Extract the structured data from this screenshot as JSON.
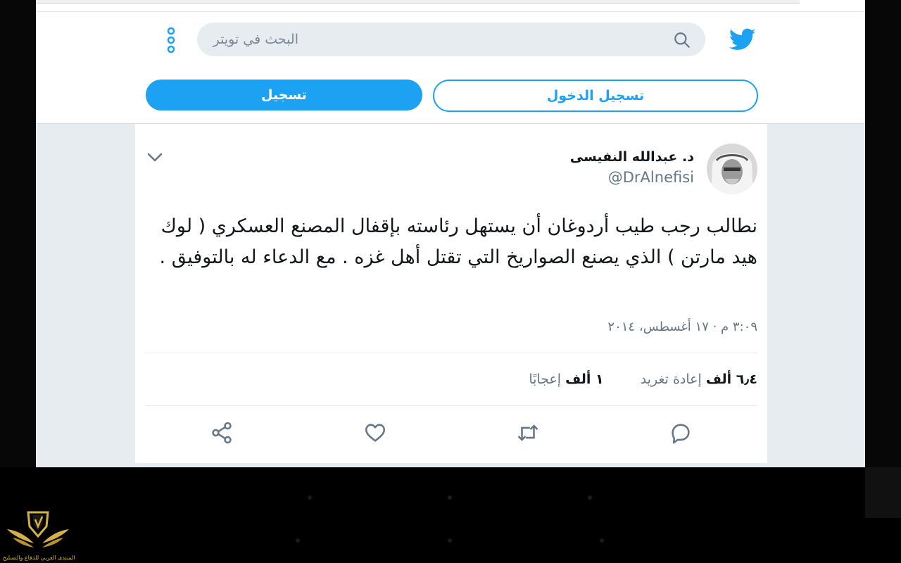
{
  "header": {
    "search_placeholder": "البحث في تويتر",
    "login_label": "تسجيل الدخول",
    "signup_label": "تسجيل"
  },
  "tweet": {
    "author_name": "د. عبدالله النفيسى",
    "author_handle": "@DrAlnefisi",
    "text": "نطالب رجب طيب أردوغان أن يستهل رئاسته بإقفال المصنع العسكري ( لوك هيد مارتن ) الذي يصنع الصواريخ التي تقتل أهل غزه . مع الدعاء له بالتوفيق .",
    "timestamp": "٣:٠٩ م · ١٧ أغسطس، ٢٠١٤",
    "retweets_count": "٦٫٤ ألف",
    "retweets_label": "إعادة تغريد",
    "likes_count": "١ ألف",
    "likes_label": "إعجابًا"
  },
  "icons": {
    "brand": "twitter-bird-icon",
    "search": "search-icon",
    "more": "more-options-icon",
    "caret": "chevron-down-icon",
    "reply": "reply-icon",
    "retweet": "retweet-icon",
    "like": "heart-icon",
    "share": "share-icon"
  },
  "colors": {
    "accent": "#1da1f2",
    "text": "#14171a",
    "muted": "#657786",
    "background": "#e6ecf0"
  },
  "watermark": {
    "caption": "المنتدى العربي للدفاع والتسليح"
  }
}
